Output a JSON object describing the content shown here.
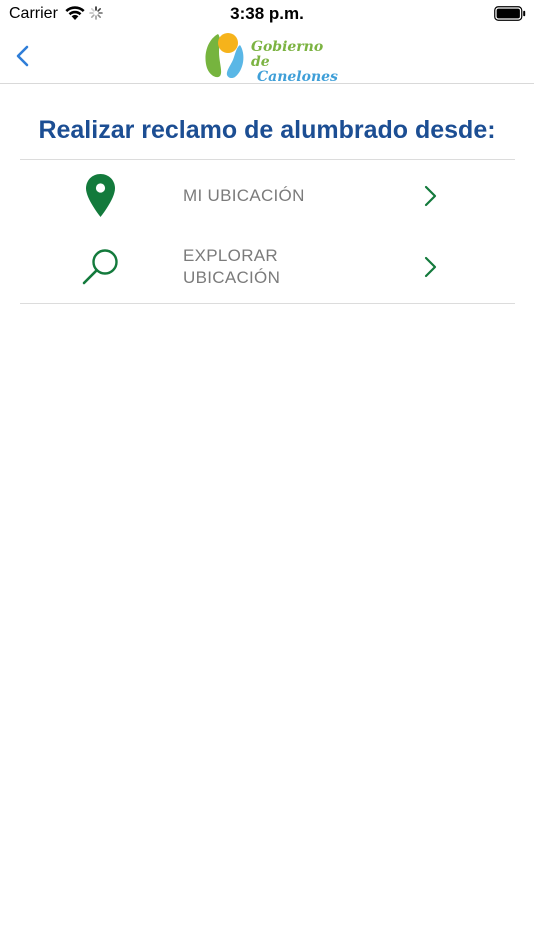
{
  "status_bar": {
    "carrier": "Carrier",
    "time": "3:38 p.m."
  },
  "nav": {
    "back_icon": "chevron-left-icon",
    "logo": {
      "line1": "Gobierno de",
      "line2": "Canelones"
    }
  },
  "main": {
    "title": "Realizar reclamo de alumbrado desde:",
    "options": [
      {
        "label_line1": "MI UBICACIÓN",
        "label_line2": "",
        "icon": "location-pin-icon"
      },
      {
        "label_line1": "EXPLORAR",
        "label_line2": "UBICACIÓN",
        "icon": "search-icon"
      }
    ]
  },
  "colors": {
    "title": "#1c4e93",
    "accent_green": "#137a3c",
    "label_gray": "#7b7b7b",
    "back_blue": "#2f7ed8"
  }
}
